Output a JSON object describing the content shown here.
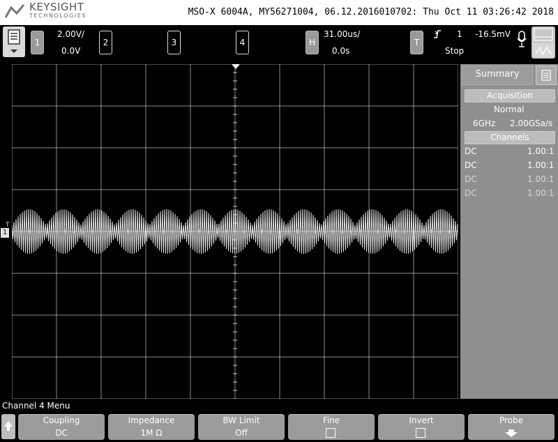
{
  "header": {
    "brand": "KEYSIGHT",
    "brand_sub": "TECHNOLOGIES",
    "title": "MSO-X 6004A, MY56271004, 06.12.2016010702: Thu Oct 11 03:26:42 2018"
  },
  "status": {
    "channels": [
      {
        "number": "1",
        "scale": "2.00V/",
        "offset": "0.0V"
      },
      {
        "number": "2"
      },
      {
        "number": "3"
      },
      {
        "number": "4"
      }
    ],
    "horizontal": {
      "label": "H",
      "scale": "31.00us/",
      "delay": "0.0s"
    },
    "trigger": {
      "label": "T",
      "source": "1",
      "level": "-16.5mV",
      "state": "Stop"
    }
  },
  "waveform": {
    "channel_marker": "1",
    "trigger_marker": "T",
    "envelope_cycles": 13
  },
  "sidepanel": {
    "tab_summary": "Summary",
    "acquisition_header": "Acquisition",
    "mode": "Normal",
    "bandwidth": "6GHz",
    "sample_rate": "2.00GSa/s",
    "channels_header": "Channels",
    "channel_rows": [
      {
        "coupling": "DC",
        "ratio": "1.00:1"
      },
      {
        "coupling": "DC",
        "ratio": "1.00:1"
      },
      {
        "coupling": "DC",
        "ratio": "1.00:1"
      },
      {
        "coupling": "DC",
        "ratio": "1.00:1"
      }
    ]
  },
  "menu": {
    "title": "Channel 4 Menu",
    "softkeys": [
      {
        "label": "Coupling",
        "value": "DC"
      },
      {
        "label": "Impedance",
        "value": "1M Ω"
      },
      {
        "label": "BW Limit",
        "value": "Off"
      },
      {
        "label": "Fine"
      },
      {
        "label": "Invert"
      },
      {
        "label": "Probe"
      }
    ]
  },
  "colors": {
    "background": "#000000",
    "trace": "#e6e6e6",
    "grid": "#ffffff",
    "panel": "#8f8f8f"
  }
}
